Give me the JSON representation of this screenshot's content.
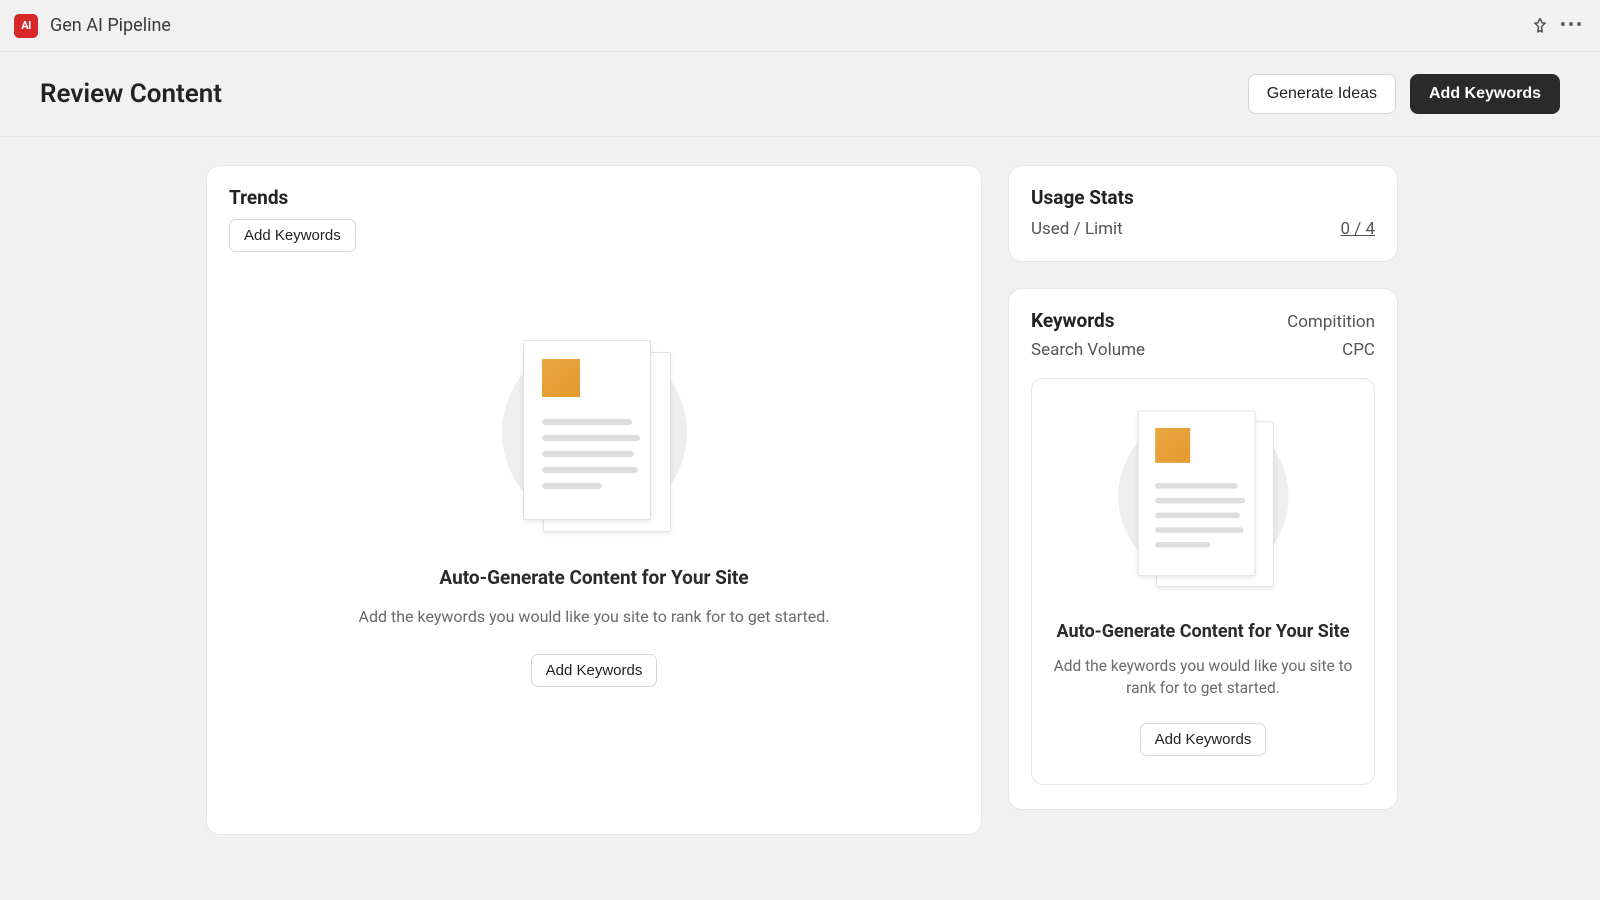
{
  "app": {
    "logo_text": "AI",
    "title": "Gen AI Pipeline"
  },
  "page": {
    "title": "Review Content",
    "generate_ideas_label": "Generate Ideas",
    "add_keywords_label": "Add Keywords"
  },
  "trends": {
    "title": "Trends",
    "add_keywords_label": "Add Keywords",
    "empty": {
      "heading": "Auto-Generate Content for Your Site",
      "sub": "Add the keywords you would like you site to rank for to get started.",
      "cta": "Add Keywords"
    }
  },
  "usage": {
    "title": "Usage Stats",
    "label": "Used / Limit",
    "value": "0 / 4"
  },
  "keywords": {
    "title": "Keywords",
    "competition_label": "Compitition",
    "search_volume_label": "Search Volume",
    "cpc_label": "CPC",
    "empty": {
      "heading": "Auto-Generate Content for Your Site",
      "sub": "Add the keywords you would like you site to rank for to get started.",
      "cta": "Add Keywords"
    }
  }
}
